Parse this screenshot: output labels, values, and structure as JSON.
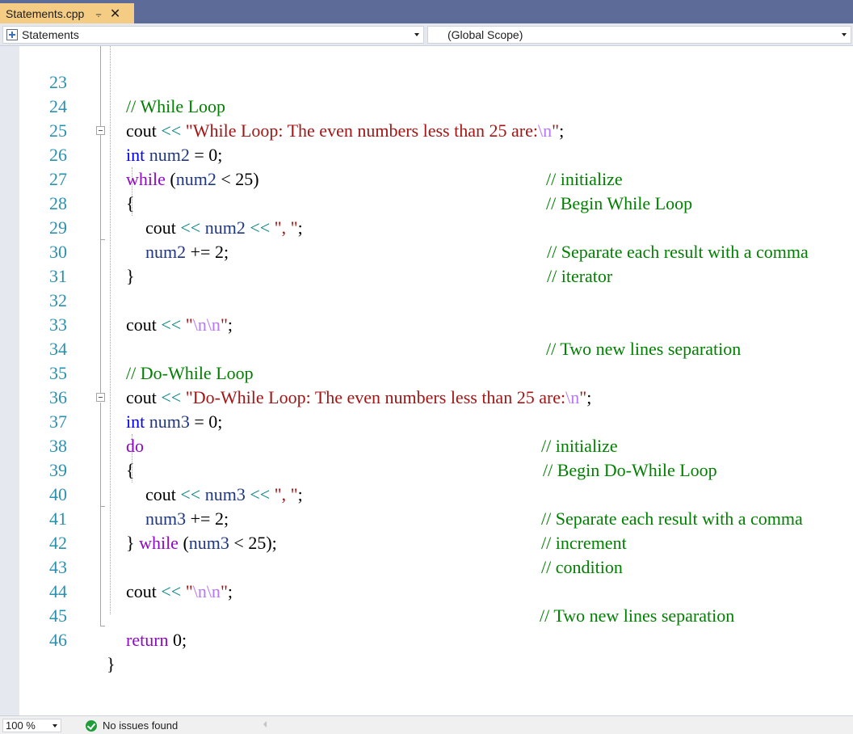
{
  "tab": {
    "filename": "Statements.cpp",
    "pin_glyph": "⨪",
    "close_glyph": "✕"
  },
  "navbar": {
    "project": "Statements",
    "scope": "(Global Scope)"
  },
  "lines": {
    "l23": {
      "num": "23",
      "text": "// While Loop"
    },
    "l24": {
      "num": "24",
      "a": "cout ",
      "b": "<< ",
      "c": "\"While Loop: The even numbers less than 25 are:",
      "d": "\\n",
      "e": "\"",
      "f": ";"
    },
    "l25": {
      "num": "25",
      "a": "int",
      "b": " num2",
      "c": " = 0;",
      "comment": "// initialize"
    },
    "l26": {
      "num": "26",
      "a": "while",
      "b": " (",
      "c": "num2",
      "d": " < 25)",
      "comment": "// Begin While Loop"
    },
    "l27": {
      "num": "27",
      "a": "{"
    },
    "l28": {
      "num": "28",
      "a": "cout ",
      "b": "<< ",
      "c": "num2",
      "d": " << ",
      "e": "\", \"",
      "f": ";",
      "comment": "// Separate each result with a comma"
    },
    "l29": {
      "num": "29",
      "a": "num2",
      "b": " += 2;",
      "comment": "// iterator"
    },
    "l30": {
      "num": "30",
      "a": "}"
    },
    "l31": {
      "num": "31"
    },
    "l32": {
      "num": "32",
      "a": "cout ",
      "b": "<< ",
      "c": "\"",
      "d": "\\n\\n",
      "e": "\"",
      "f": ";",
      "comment": "// Two new lines separation"
    },
    "l33": {
      "num": "33"
    },
    "l34": {
      "num": "34",
      "text": "// Do-While Loop"
    },
    "l35": {
      "num": "35",
      "a": "cout ",
      "b": "<< ",
      "c": "\"Do-While Loop: The even numbers less than 25 are:",
      "d": "\\n",
      "e": "\"",
      "f": ";"
    },
    "l36": {
      "num": "36",
      "a": "int",
      "b": " num3",
      "c": " = 0;",
      "comment": "// initialize"
    },
    "l37": {
      "num": "37",
      "a": "do",
      "comment": "// Begin Do-While Loop"
    },
    "l38": {
      "num": "38",
      "a": "{"
    },
    "l39": {
      "num": "39",
      "a": "cout ",
      "b": "<< ",
      "c": "num3",
      "d": " << ",
      "e": "\", \"",
      "f": ";",
      "comment": "// Separate each result with a comma"
    },
    "l40": {
      "num": "40",
      "a": "num3",
      "b": " += 2;",
      "comment": "// increment"
    },
    "l41": {
      "num": "41",
      "a": "} ",
      "b": "while",
      "c": " (",
      "d": "num3",
      "e": " < 25);",
      "comment": "// condition"
    },
    "l42": {
      "num": "42"
    },
    "l43": {
      "num": "43",
      "a": "cout ",
      "b": "<< ",
      "c": "\"",
      "d": "\\n\\n",
      "e": "\"",
      "f": ";",
      "comment": "// Two new lines separation"
    },
    "l44": {
      "num": "44"
    },
    "l45": {
      "num": "45",
      "a": "return",
      "b": " 0;"
    },
    "l46": {
      "num": "46",
      "a": "}"
    }
  },
  "status": {
    "zoom": "100 %",
    "issues": "No issues found"
  },
  "colors": {
    "tab_active": "#f5cc84",
    "tabstrip": "#5d6b99",
    "line_number": "#2b91af",
    "comment": "#008000",
    "keyword": "#0000ff",
    "control_keyword": "#8f08c4",
    "string": "#a31515",
    "escape": "#b776fb",
    "operator": "#008080",
    "variable": "#1f377f"
  }
}
